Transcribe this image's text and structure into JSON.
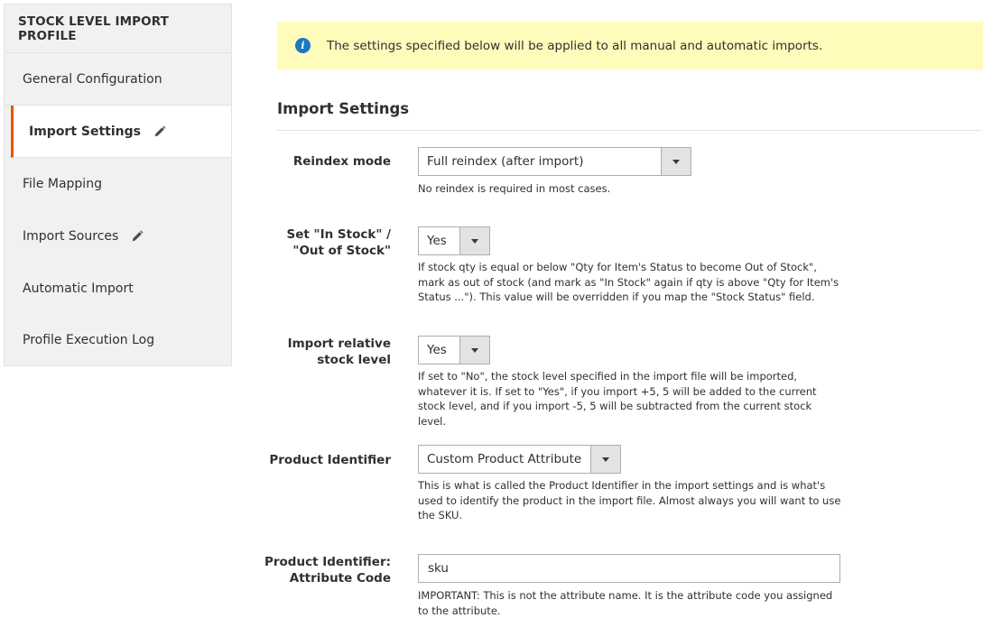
{
  "sidebar": {
    "title": "STOCK LEVEL IMPORT PROFILE",
    "items": [
      {
        "label": "General Configuration"
      },
      {
        "label": "Import Settings"
      },
      {
        "label": "File Mapping"
      },
      {
        "label": "Import Sources"
      },
      {
        "label": "Automatic Import"
      },
      {
        "label": "Profile Execution Log"
      }
    ]
  },
  "notice": {
    "text": "The settings specified below will be applied to all manual and automatic imports."
  },
  "section": {
    "title": "Import Settings"
  },
  "fields": {
    "reindex_mode": {
      "label": "Reindex mode",
      "value": "Full reindex (after import)",
      "note": "No reindex is required in most cases."
    },
    "set_in_stock": {
      "label_line1": "Set \"In Stock\" /",
      "label_line2": "\"Out of Stock\"",
      "value": "Yes",
      "note": "If stock qty is equal or below \"Qty for Item's Status to become Out of Stock\", mark as out of stock (and mark as \"In Stock\" again if qty is above \"Qty for Item's Status ...\"). This value will be overridden if you map the \"Stock Status\" field."
    },
    "import_relative": {
      "label_line1": "Import relative",
      "label_line2": "stock level",
      "value": "Yes",
      "note": "If set to \"No\", the stock level specified in the import file will be imported, whatever it is. If set to \"Yes\", if you import +5, 5 will be added to the current stock level, and if you import -5, 5 will be subtracted from the current stock level."
    },
    "product_identifier": {
      "label": "Product Identifier",
      "value": "Custom Product Attribute",
      "note": "This is what is called the Product Identifier in the import settings and is what's used to identify the product in the import file. Almost always you will want to use the SKU."
    },
    "attribute_code": {
      "label_line1": "Product Identifier:",
      "label_line2": "Attribute Code",
      "value": "sku",
      "note": "IMPORTANT: This is not the attribute name. It is the attribute code you assigned to the attribute."
    }
  },
  "colors": {
    "accent": "#eb5202",
    "info": "#1979c3",
    "notice_bg": "#fffbbb"
  }
}
